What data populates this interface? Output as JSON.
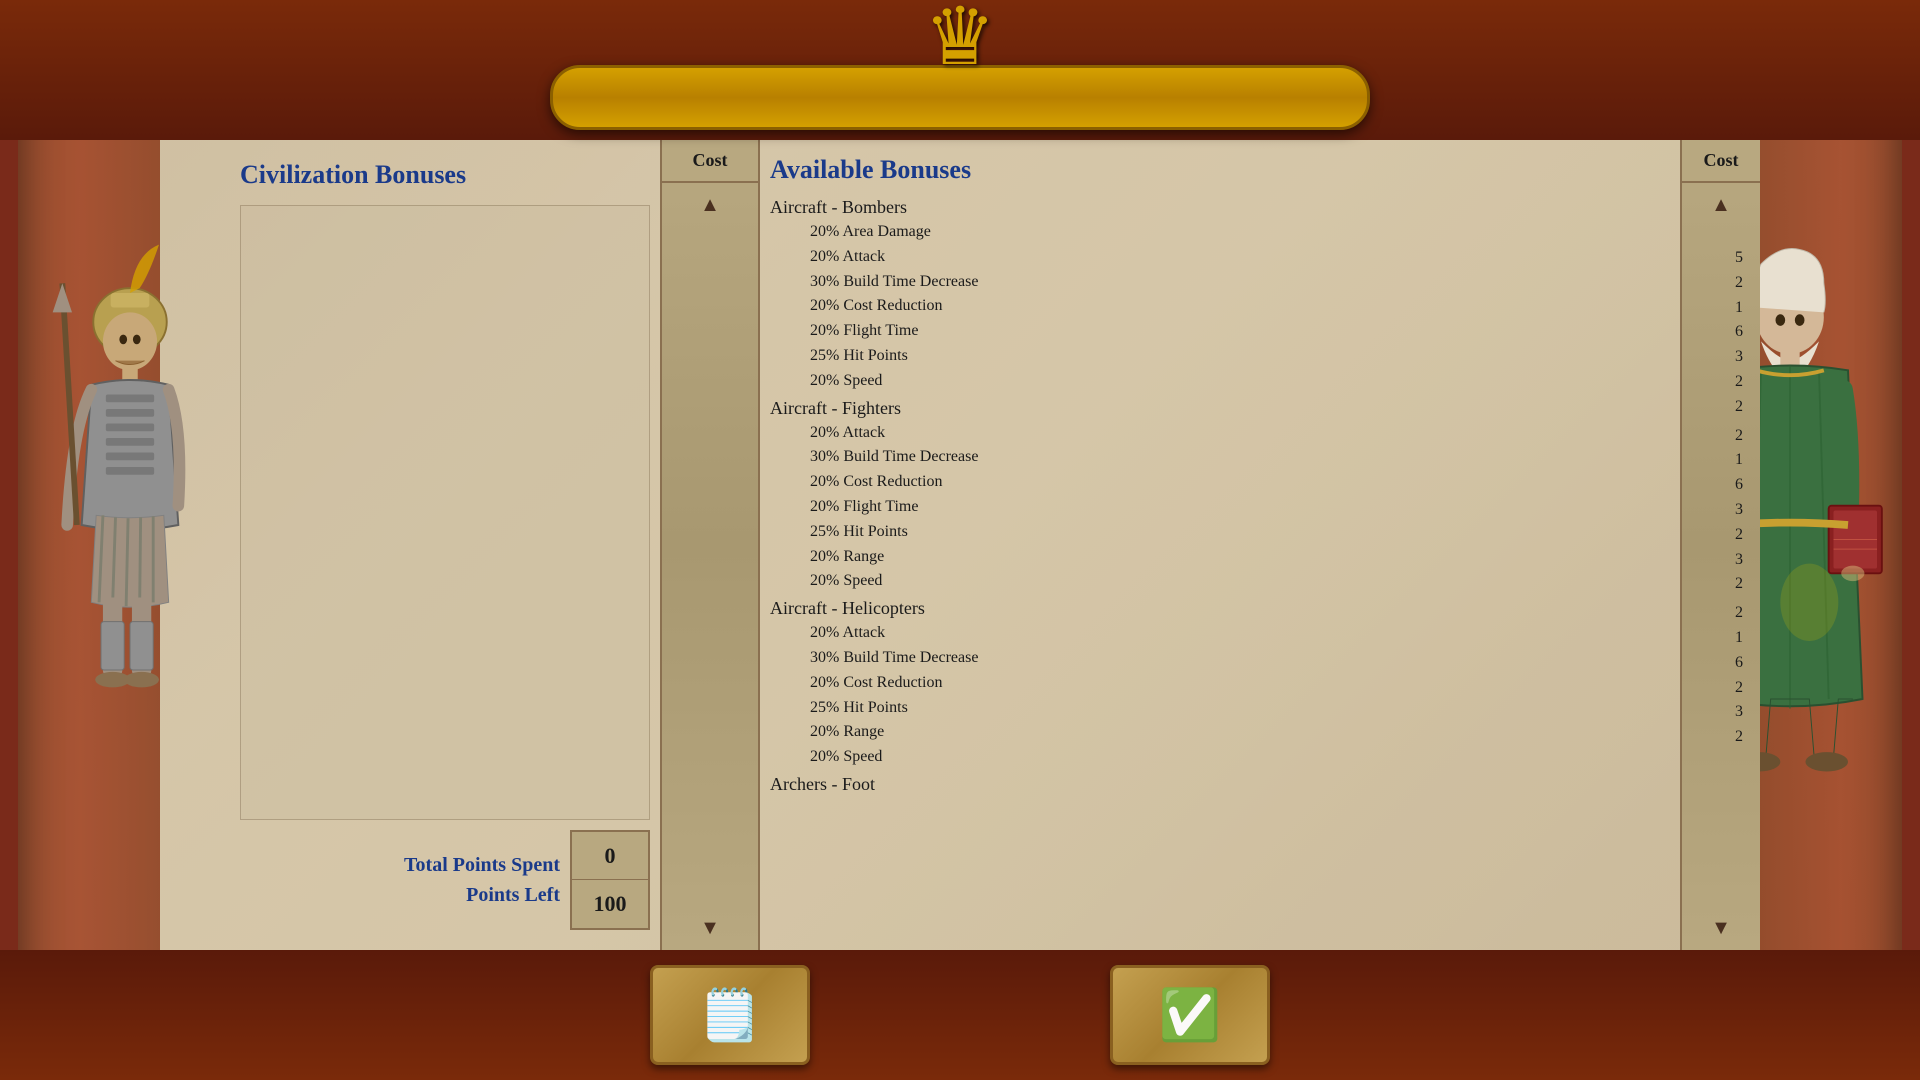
{
  "title": "",
  "crown": "♛",
  "panels": {
    "left": {
      "title": "Civilization Bonuses",
      "points_spent_label": "Total Points Spent",
      "points_left_label": "Points Left",
      "points_spent_value": "0",
      "points_left_value": "100"
    },
    "right": {
      "title": "Available Bonuses",
      "cost_header": "Cost",
      "categories": [
        {
          "name": "Aircraft - Bombers",
          "items": [
            {
              "label": "20% Area Damage",
              "cost": "5"
            },
            {
              "label": "20% Attack",
              "cost": "2"
            },
            {
              "label": "30% Build Time Decrease",
              "cost": "1"
            },
            {
              "label": "20% Cost Reduction",
              "cost": "6"
            },
            {
              "label": "20% Flight Time",
              "cost": "3"
            },
            {
              "label": "25% Hit Points",
              "cost": "2"
            },
            {
              "label": "20% Speed",
              "cost": "2"
            }
          ]
        },
        {
          "name": "Aircraft - Fighters",
          "items": [
            {
              "label": "20% Attack",
              "cost": "2"
            },
            {
              "label": "30% Build Time Decrease",
              "cost": "1"
            },
            {
              "label": "20% Cost Reduction",
              "cost": "6"
            },
            {
              "label": "20% Flight Time",
              "cost": "3"
            },
            {
              "label": "25% Hit Points",
              "cost": "2"
            },
            {
              "label": "20% Range",
              "cost": "3"
            },
            {
              "label": "20% Speed",
              "cost": "2"
            }
          ]
        },
        {
          "name": "Aircraft - Helicopters",
          "items": [
            {
              "label": "20% Attack",
              "cost": "2"
            },
            {
              "label": "30% Build Time Decrease",
              "cost": "1"
            },
            {
              "label": "20% Cost Reduction",
              "cost": "6"
            },
            {
              "label": "25% Hit Points",
              "cost": "2"
            },
            {
              "label": "20% Range",
              "cost": "3"
            },
            {
              "label": "20% Speed",
              "cost": "2"
            }
          ]
        },
        {
          "name": "Archers - Foot",
          "items": []
        }
      ]
    },
    "middle": {
      "cost_header": "Cost"
    }
  },
  "buttons": {
    "cancel_icon": "📄",
    "confirm_icon": "✅"
  },
  "colors": {
    "title_blue": "#1a3a8a",
    "frame_red": "#7a2a1a",
    "gold": "#d4a000",
    "parchment": "#d4c4a8"
  }
}
